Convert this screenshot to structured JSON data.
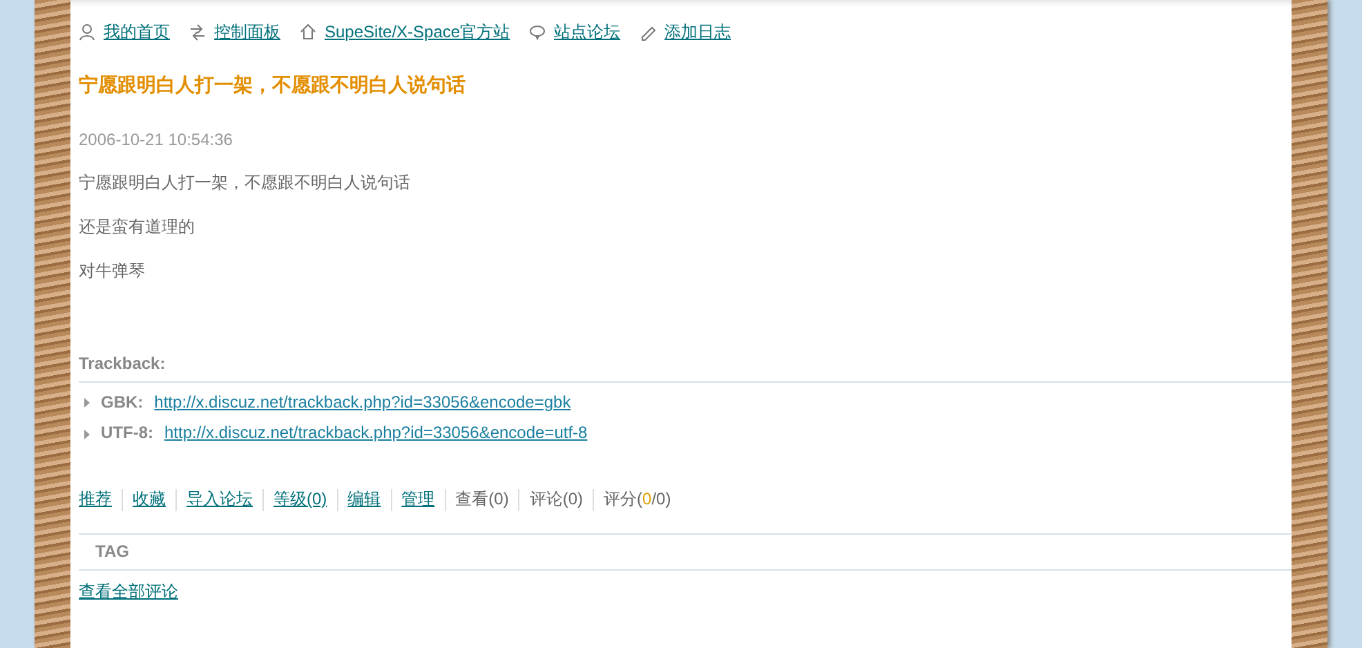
{
  "nav": [
    {
      "kind": "person",
      "label": "我的首页"
    },
    {
      "kind": "arrows",
      "label": "控制面板"
    },
    {
      "kind": "house",
      "label": "SupeSite/X-Space官方站"
    },
    {
      "kind": "bubble",
      "label": "站点论坛"
    },
    {
      "kind": "pencil",
      "label": "添加日志"
    }
  ],
  "post": {
    "title": "宁愿跟明白人打一架，不愿跟不明白人说句话",
    "date": "2006-10-21 10:54:36",
    "paragraphs": [
      "宁愿跟明白人打一架，不愿跟不明白人说句话",
      "还是蛮有道理的",
      "对牛弹琴"
    ]
  },
  "trackback": {
    "label": "Trackback:",
    "items": [
      {
        "label": "GBK:",
        "url": "http://x.discuz.net/trackback.php?id=33056&encode=gbk"
      },
      {
        "label": "UTF-8:",
        "url": "http://x.discuz.net/trackback.php?id=33056&encode=utf-8"
      }
    ]
  },
  "actions": [
    {
      "kind": "link",
      "text": "推荐"
    },
    {
      "kind": "link",
      "text": "收藏"
    },
    {
      "kind": "link",
      "text": "导入论坛"
    },
    {
      "kind": "link",
      "text": "等级(0)"
    },
    {
      "kind": "link",
      "text": "编辑"
    },
    {
      "kind": "link",
      "text": "管理"
    },
    {
      "kind": "stat",
      "text": "查看(0)"
    },
    {
      "kind": "stat",
      "text": "评论(0)"
    },
    {
      "kind": "score",
      "prefix": "评分(",
      "score": "0",
      "suffix": "/0)"
    }
  ],
  "tag_label": "TAG",
  "all_comments": "查看全部评论"
}
